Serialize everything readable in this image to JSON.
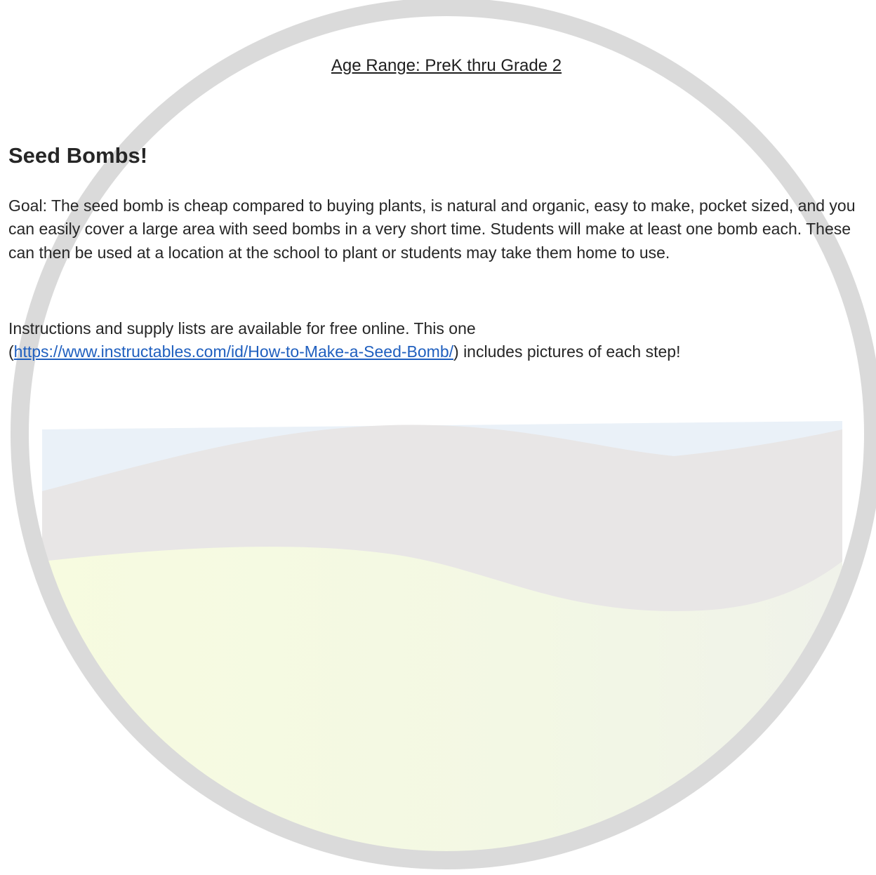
{
  "header": {
    "age_range": "Age Range: PreK thru Grade 2"
  },
  "document": {
    "title": "Seed Bombs!",
    "goal": "Goal: The seed bomb is cheap compared to buying plants, is natural and organic, easy to make, pocket sized, and you can easily cover a large area with seed bombs in a very short time.  Students will make at least one bomb each.  These can then be used at a location at the school to plant or students may take them home to use.",
    "instructions_intro": "Instructions and supply lists are available for free online.  This one",
    "instructions_open_paren": "(",
    "instructions_link": "https://www.instructables.com/id/How-to-Make-a-Seed-Bomb/",
    "instructions_tail": ") includes pictures of each step!"
  },
  "colors": {
    "ring": "#dadada",
    "sky": "#eaf1f8",
    "hill": "#e8e6e6",
    "field": "#f4f8e2",
    "link": "#1f5fbf"
  }
}
